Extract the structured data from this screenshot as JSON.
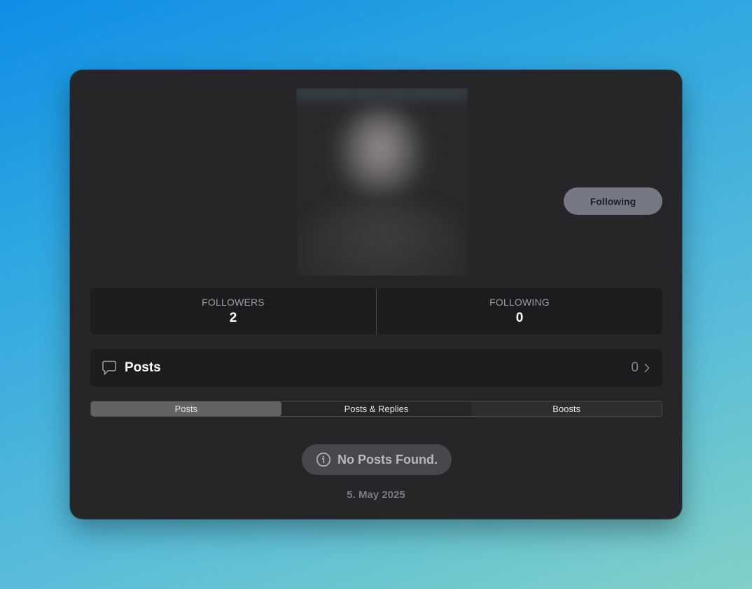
{
  "profile": {
    "follow_button_label": "Following"
  },
  "stats": [
    {
      "label": "FOLLOWERS",
      "value": "2"
    },
    {
      "label": "FOLLOWING",
      "value": "0"
    }
  ],
  "posts_section": {
    "icon": "speech-bubble-icon",
    "title": "Posts",
    "count": "0",
    "chevron_icon": "chevron-right-icon"
  },
  "tabs": [
    {
      "label": "Posts",
      "selected": true
    },
    {
      "label": "Posts & Replies",
      "selected": false
    },
    {
      "label": "Boosts",
      "selected": false
    }
  ],
  "empty_state": {
    "icon": "info-icon",
    "message": "No Posts Found."
  },
  "date": "5. May 2025",
  "colors": {
    "window_background": "#262628",
    "panel_background": "#1c1c1e",
    "follow_button": "#767883",
    "selected_tab": "#636366"
  }
}
